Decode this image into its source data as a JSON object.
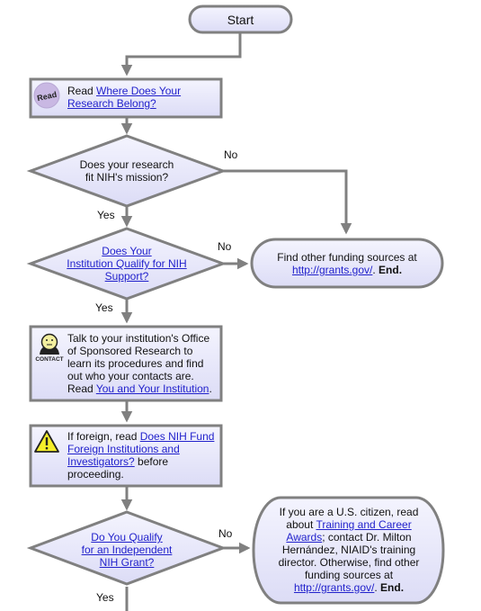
{
  "colors": {
    "node_fill": "#e6e6fb",
    "node_border": "#808080",
    "connector": "#808080",
    "link": "#2222cc"
  },
  "start": {
    "label": "Start"
  },
  "read_step": {
    "icon": "read-icon",
    "icon_text": "Read",
    "prefix": "Read ",
    "link": "Where Does Your Research Belong?"
  },
  "decision_mission": {
    "line1": "Does your research",
    "line2": "fit NIH's mission?",
    "yes_label": "Yes",
    "no_label": "No"
  },
  "decision_institution": {
    "link_line1": "Does Your",
    "link_line2": "Institution Qualify for NIH",
    "link_line3": "Support?",
    "yes_label": "Yes",
    "no_label": "No"
  },
  "end_other_funding": {
    "text": "Find other funding sources at",
    "link": "http://grants.gov/",
    "after_link": ". ",
    "end_label": "End."
  },
  "contact_step": {
    "icon": "contact-icon",
    "icon_text": "CONTACT",
    "text": "Talk to your institution's Office of Sponsored Research to learn its procedures and find out who your contacts are. Read ",
    "link": "You and Your Institution",
    "after_link": "."
  },
  "foreign_step": {
    "icon": "warning-icon",
    "prefix": "If foreign, read ",
    "link": "Does NIH Fund Foreign Institutions and Investigators?",
    "suffix": " before proceeding."
  },
  "decision_independent": {
    "link_line1": "Do You Qualify",
    "link_line2": "for an Independent",
    "link_line3": "NIH Grant?",
    "yes_label": "Yes",
    "no_label": "No"
  },
  "end_training": {
    "prefix": "If you are a U.S. citizen, read about ",
    "link1": "Training and Career Awards",
    "middle": "; contact Dr. Milton Hernández, NIAID's training director. Otherwise, find other funding sources at ",
    "link2": "http://grants.gov/",
    "after_link": ". ",
    "end_label": "End."
  }
}
